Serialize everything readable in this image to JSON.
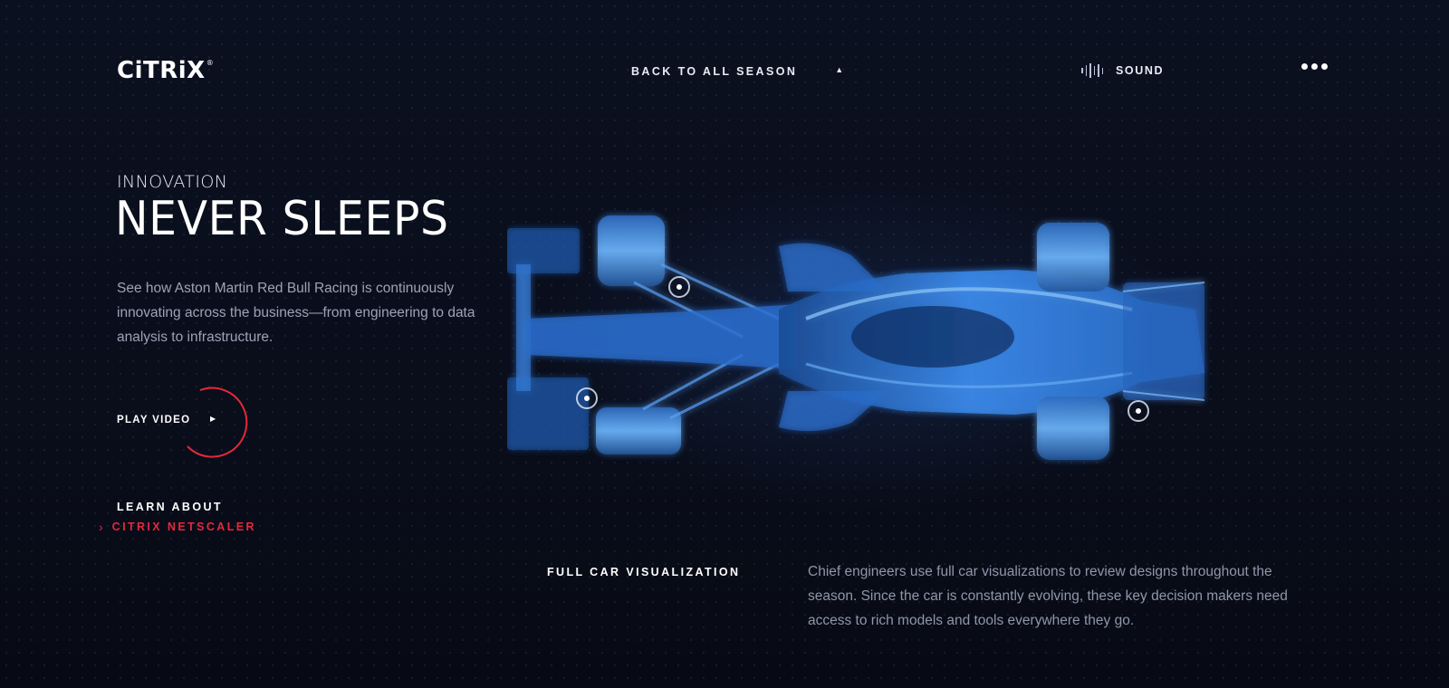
{
  "header": {
    "logo_text": "CiTRiX",
    "logo_mark": "®",
    "back_label": "BACK TO ALL SEASON",
    "back_icon": "triangle-up-icon",
    "sound_icon": "sound-bars-icon",
    "sound_label": "SOUND",
    "menu_icon": "more-dots-icon"
  },
  "hero": {
    "eyebrow": "INNOVATION",
    "headline": "NEVER SLEEPS",
    "intro": "See how Aston Martin Red Bull Racing is continuously innovating across the business—from engineering to data analysis to infrastructure."
  },
  "play": {
    "label": "PLAY VIDEO",
    "icon": "play-icon"
  },
  "learn": {
    "label": "LEARN ABOUT",
    "link": "CITRIX NETSCALER",
    "link_icon": "chevron-right-icon"
  },
  "visual": {
    "car_image": "f1-car-xray-visualization",
    "hotspot_icon": "hotspot-icon"
  },
  "section": {
    "title": "FULL CAR VISUALIZATION",
    "body": "Chief engineers use full car visualizations to review designs throughout the season. Since the car is constantly evolving, these key decision makers need access to rich models and tools everywhere they go."
  },
  "colors": {
    "background": "#0a0e1b",
    "accent_red": "#e5283c",
    "car_blue": "#4aa3ff",
    "text_muted": "#9ba3b6"
  }
}
